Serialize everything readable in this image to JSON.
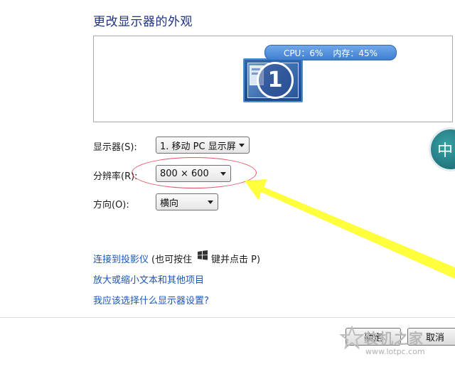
{
  "page": {
    "title": "更改显示器的外观"
  },
  "preview": {
    "monitor_number": "1",
    "cpu_label": "CPU：6%",
    "memory_label": "内存：45%"
  },
  "form": {
    "display_label": "显示器(S):",
    "display_value": "1. 移动 PC 显示屏",
    "resolution_label": "分辨率(R):",
    "resolution_value": "800 × 600",
    "orientation_label": "方向(O):",
    "orientation_value": "横向"
  },
  "links": {
    "projector": "连接到投影仪",
    "projector_hint_pre": "(也可按住",
    "projector_hint_post": "键并点击 P)",
    "text_size": "放大或缩小文本和其他项目",
    "which_settings": "我应该选择什么显示器设置?"
  },
  "buttons": {
    "ok": "确定",
    "cancel": "取消"
  },
  "overlay": {
    "badge_text": "中",
    "watermark_title": "装机之家",
    "watermark_url": "www.lotpc.com"
  },
  "colors": {
    "accent_arrow": "#ffff3c",
    "highlight": "#e25566",
    "link": "#1b57b8"
  },
  "icons": {
    "monitor": "monitor-icon",
    "windows_key": "windows-logo-icon",
    "dropdown": "chevron-down-icon"
  }
}
